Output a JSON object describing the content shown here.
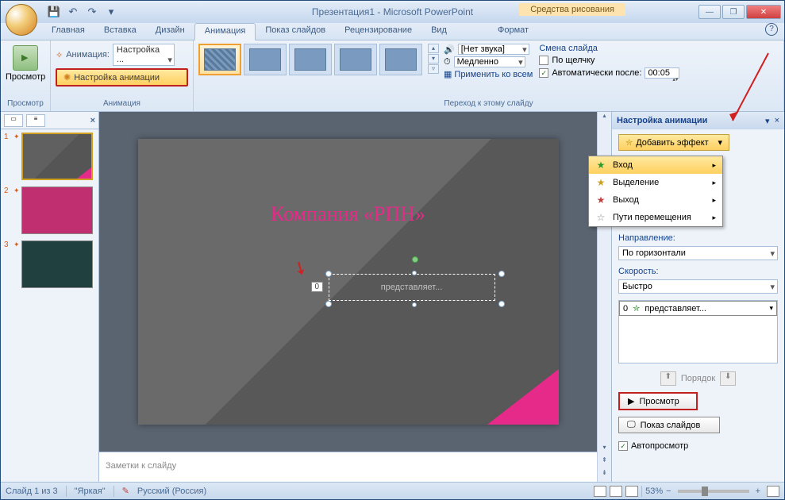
{
  "window": {
    "title": "Презентация1 - Microsoft PowerPoint",
    "contextual_tab": "Средства рисования"
  },
  "tabs": {
    "home": "Главная",
    "insert": "Вставка",
    "design": "Дизайн",
    "animation": "Анимация",
    "slideshow": "Показ слайдов",
    "review": "Рецензирование",
    "view": "Вид",
    "format": "Формат"
  },
  "ribbon": {
    "preview": "Просмотр",
    "preview_group": "Просмотр",
    "anim_label": "Анимация:",
    "anim_value": "Настройка ...",
    "custom_anim": "Настройка анимации",
    "anim_group": "Анимация",
    "sound_label": "[Нет звука]",
    "speed_label": "Медленно",
    "apply_all": "Применить ко всем",
    "trans_group": "Переход к этому слайду",
    "change_title": "Смена слайда",
    "on_click": "По щелчку",
    "auto_after": "Автоматически после:",
    "auto_time": "00:05"
  },
  "slide": {
    "title": "Компания «РПН»",
    "subtitle": "представляет...",
    "anim_tag": "0"
  },
  "notes": {
    "placeholder": "Заметки к слайду"
  },
  "taskpane": {
    "title": "Настройка анимации",
    "add_effect": "Добавить эффект",
    "menu": {
      "entrance": "Вход",
      "emphasis": "Выделение",
      "exit": "Выход",
      "motion": "Пути перемещения"
    },
    "direction_label": "Направление:",
    "direction_value": "По горизонтали",
    "speed_label": "Скорость:",
    "speed_value": "Быстро",
    "list_item_num": "0",
    "list_item_text": "представляет...",
    "order": "Порядок",
    "preview": "Просмотр",
    "slideshow": "Показ слайдов",
    "autopreview": "Автопросмотр"
  },
  "statusbar": {
    "slide_info": "Слайд 1 из 3",
    "theme": "\"Яркая\"",
    "lang": "Русский (Россия)",
    "zoom": "53%"
  }
}
